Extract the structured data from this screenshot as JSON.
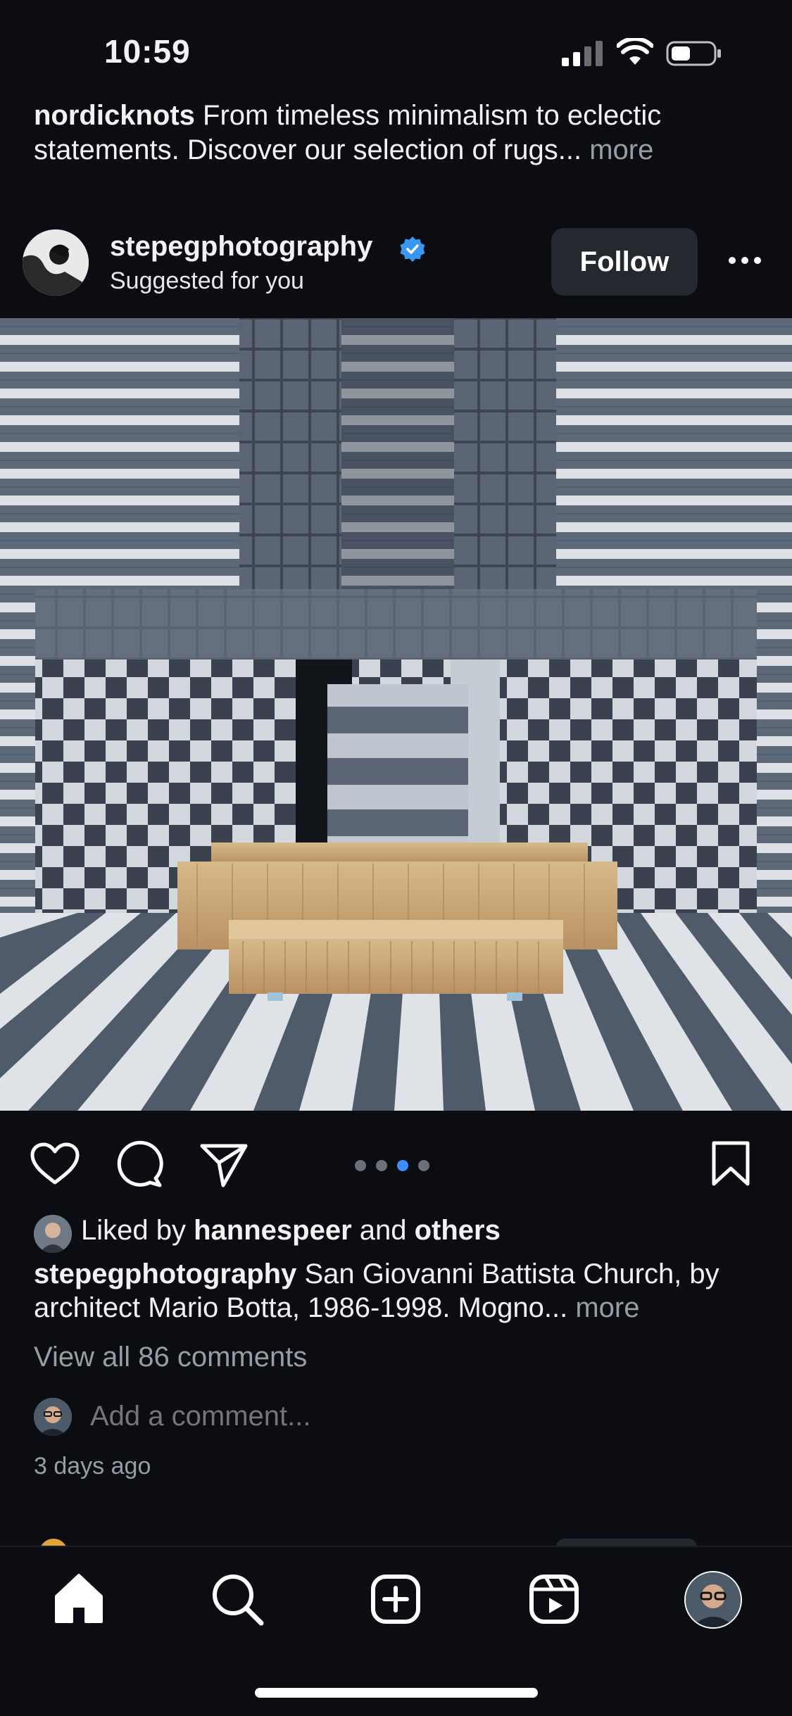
{
  "status_bar": {
    "time": "10:59"
  },
  "previous_post": {
    "username": "nordicknots",
    "caption": " From timeless minimalism to eclectic statements. Discover our selection of rugs...",
    "more_label": " more"
  },
  "post": {
    "username": "stepegphotography",
    "subtitle": "Suggested for you",
    "follow_label": "Follow",
    "image_alt": "San Giovanni Battista Church interior with striped stone walls and wooden altar",
    "carousel": {
      "count": 4,
      "active_index": 2
    },
    "likes": {
      "prefix": "Liked by ",
      "user": "hannespeer",
      "middle": " and ",
      "suffix": "others"
    },
    "caption": {
      "username": "stepegphotography",
      "text": " San Giovanni Battista Church, by architect Mario Botta, 1986-1998. Mogno...",
      "more_label": " more"
    },
    "view_comments": "View all 86 comments",
    "add_comment_placeholder": "Add a comment...",
    "timestamp": "3 days ago"
  },
  "nav": {
    "items": [
      "home-icon",
      "search-icon",
      "create-icon",
      "reels-icon",
      "profile-avatar"
    ]
  },
  "colors": {
    "background": "#0b0d12",
    "verified": "#3897f0",
    "carousel_active": "#3f8cff",
    "muted_text": "#9a9ca3",
    "button_bg": "#25282e"
  }
}
